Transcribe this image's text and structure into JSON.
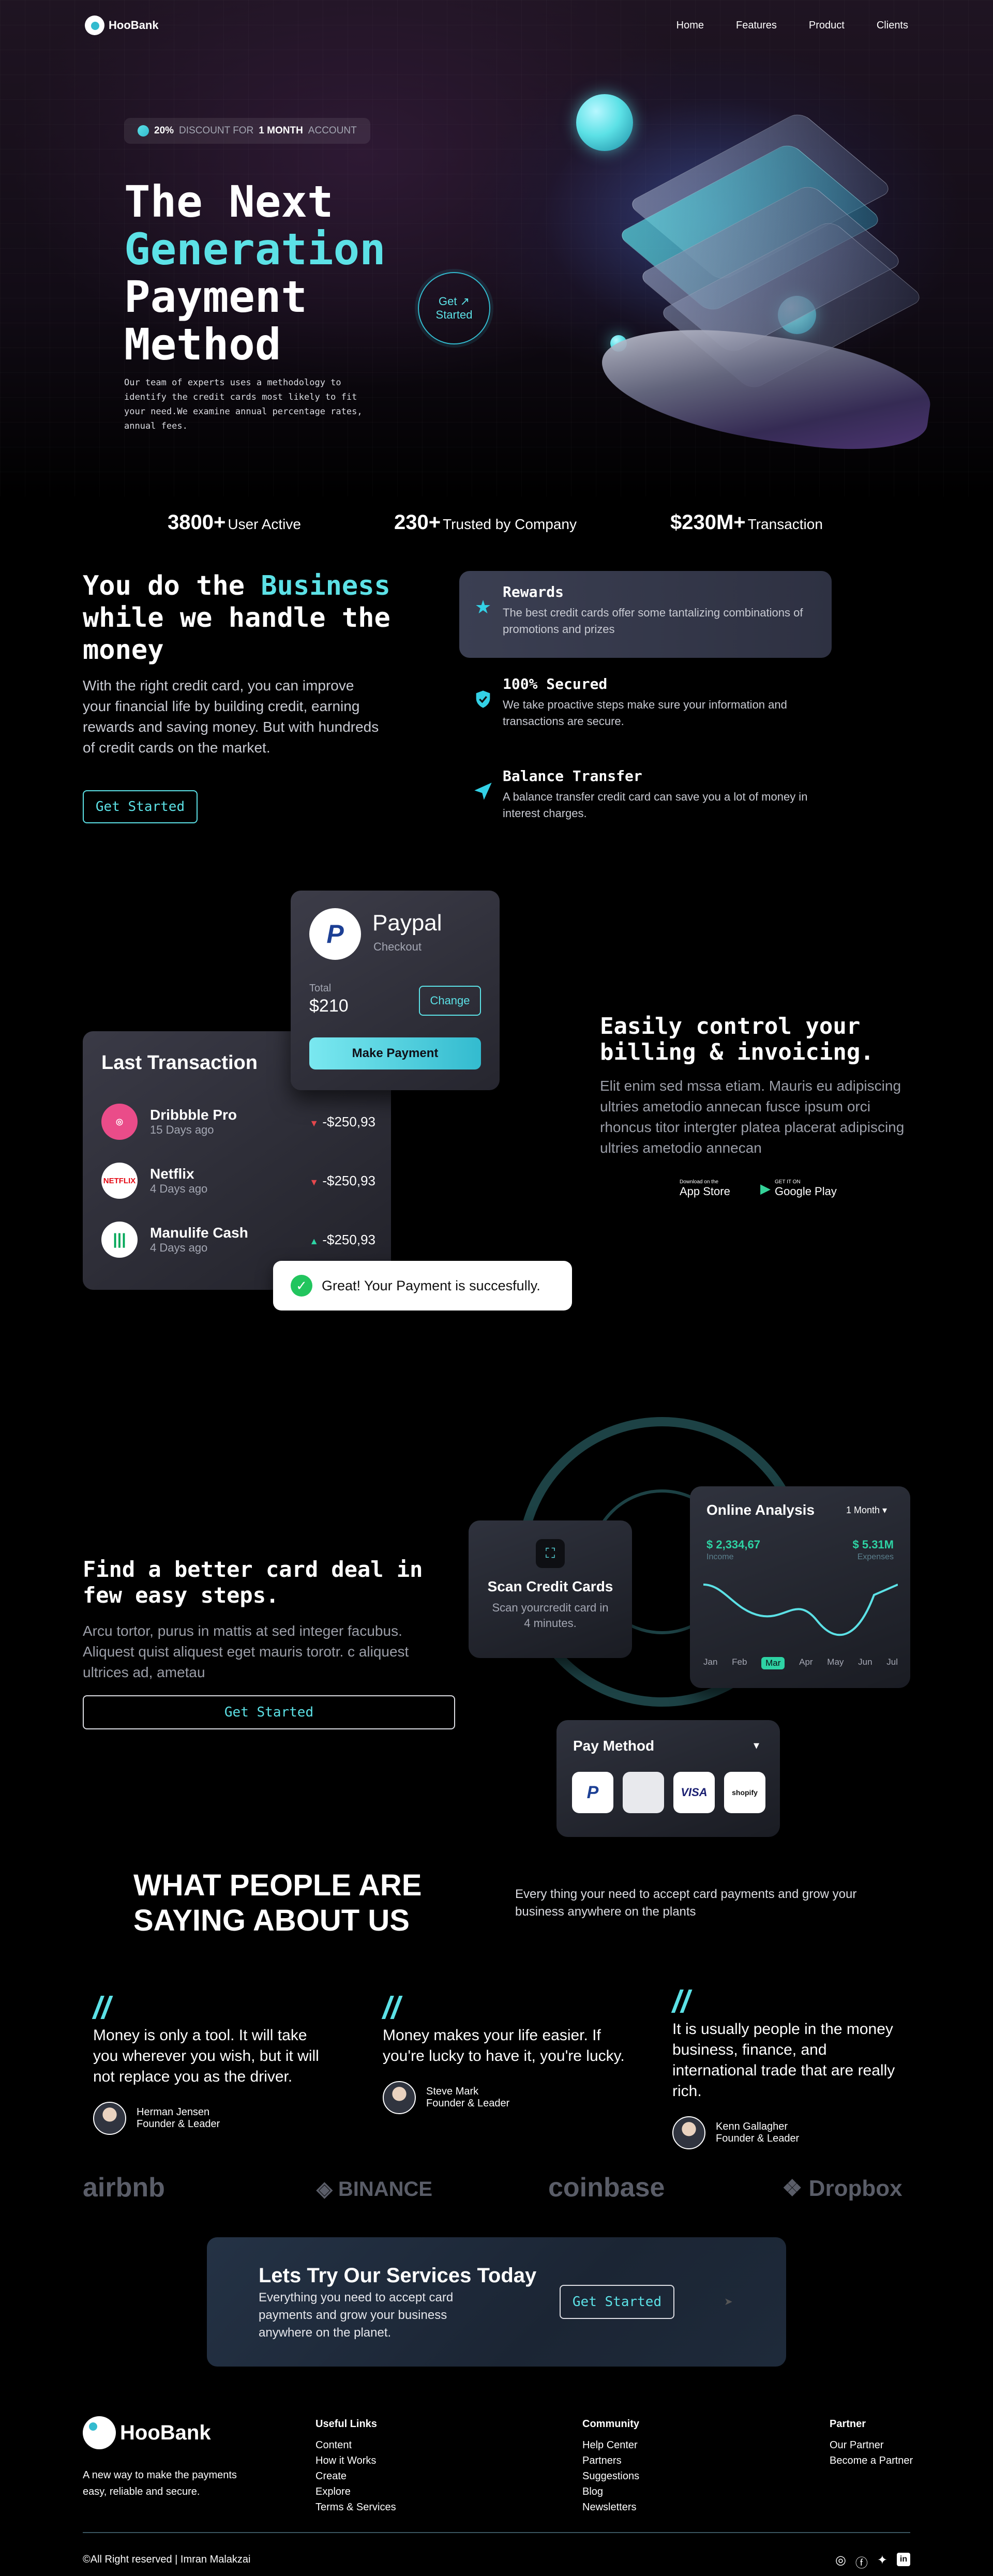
{
  "brand": {
    "name": "HooBank",
    "tagline": "A new way to make the payments easy, reliable and secure."
  },
  "nav": [
    "Home",
    "Features",
    "Product",
    "Clients"
  ],
  "hero": {
    "badge_pct": "20%",
    "badge_text1": "DISCOUNT FOR",
    "badge_text2": "1 MONTH",
    "badge_text3": "ACCOUNT",
    "title_line1": "The Next",
    "title_line2": "Generation",
    "title_line3": "Payment",
    "title_line4": "Method",
    "desc": "Our team of experts uses a methodology to identify the credit cards most likely to fit your need.We examine annual percentage rates, annual fees.",
    "cta_line1": "Get",
    "cta_line2": "Started"
  },
  "stats": [
    {
      "value": "3800+",
      "label": "User Active"
    },
    {
      "value": "230+",
      "label": "Trusted by Company"
    },
    {
      "value": "$230M+",
      "label": "Transaction"
    }
  ],
  "business": {
    "title_a": "You do the ",
    "title_b": "Business",
    "title_c": "while we handle the",
    "title_d": "money",
    "desc": "With the right credit card, you can improve your financial life by building credit, earning rewards and saving money. But with hundreds of credit cards on the market.",
    "button": "Get Started",
    "features": [
      {
        "title": "Rewards",
        "text": "The best credit cards offer some tantalizing combinations of promotions and prizes",
        "icon": "star-icon"
      },
      {
        "title": "100% Secured",
        "text": "We take proactive steps make sure your information and transactions are secure.",
        "icon": "shield-icon"
      },
      {
        "title": "Balance Transfer",
        "text": "A balance transfer credit card can save you a lot of money in interest charges.",
        "icon": "send-icon"
      }
    ]
  },
  "billing": {
    "paypal_title": "Paypal",
    "paypal_sub": "Checkout",
    "total_label": "Total",
    "total_value": "$210",
    "change": "Change",
    "make_payment": "Make Payment",
    "last_tx_title": "Last Transaction",
    "transactions": [
      {
        "name": "Dribbble Pro",
        "date": "15 Days ago",
        "amount": "-$250,93",
        "dir": "down"
      },
      {
        "name": "Netflix",
        "date": "4 Days ago",
        "amount": "-$250,93",
        "dir": "down"
      },
      {
        "name": "Manulife Cash",
        "date": "4 Days ago",
        "amount": "-$250,93",
        "dir": "up"
      }
    ],
    "toast": "Great! Your Payment is succesfully.",
    "title_line1": "Easily control your",
    "title_line2": "billing & invoicing.",
    "desc": "Elit enim sed mssa etiam. Mauris eu adipiscing ultries ametodio annecan fusce ipsum orci rhoncus titor intergter platea placerat adipiscing ultries ametodio annecan",
    "app_store_small": "Download on the",
    "app_store": "App Store",
    "google_small": "GET IT ON",
    "google": "Google Play"
  },
  "card_deal": {
    "title_line1": "Find a better card deal in",
    "title_line2": "few easy steps.",
    "desc": "Arcu tortor, purus in mattis at sed integer facubus. Aliquest quist aliquest eget mauris torotr. c aliquest ultrices ad, ametau",
    "button": "Get Started",
    "scan_title": "Scan Credit Cards",
    "scan_desc": "Scan yourcredit card in 4 minutes.",
    "analysis_title": "Online Analysis",
    "period": "1 Month",
    "income_value": "$ 2,334,67",
    "income_label": "Income",
    "expense_value": "$ 5.31M",
    "expense_label": "Expenses",
    "months": [
      "Jan",
      "Feb",
      "Mar",
      "Apr",
      "May",
      "Jun",
      "Jul"
    ],
    "active_month": "Mar",
    "pay_title": "Pay Method",
    "pay_methods": [
      "paypal",
      "apple",
      "VISA",
      "shopify"
    ]
  },
  "testimonials": {
    "title_line1": "WHAT PEOPLE ARE",
    "title_line2": "SAYING ABOUT US",
    "desc": "Every thing your need to accept card payments and grow your business anywhere on the plants",
    "items": [
      {
        "text": "Money is only a tool. It will take you wherever you wish, but it will not replace you as the driver.",
        "name": "Herman Jensen",
        "role": "Founder & Leader"
      },
      {
        "text": "Money makes your life easier. If you're lucky to have it, you're lucky.",
        "name": "Steve Mark",
        "role": "Founder & Leader"
      },
      {
        "text": "It is usually people in the money business, finance, and international trade that are really rich.",
        "name": "Kenn Gallagher",
        "role": "Founder & Leader"
      }
    ]
  },
  "clients": [
    "airbnb",
    "BINANCE",
    "coinbase",
    "Dropbox"
  ],
  "cta": {
    "title": "Lets Try Our Services Today",
    "desc": "Everything you need to accept card payments and grow your business anywhere on the planet.",
    "button": "Get Started"
  },
  "footer": {
    "cols": [
      {
        "title": "Useful Links",
        "links": [
          "Content",
          "How it Works",
          "Create",
          "Explore",
          "Terms & Services"
        ]
      },
      {
        "title": "Community",
        "links": [
          "Help Center",
          "Partners",
          "Suggestions",
          "Blog",
          "Newsletters"
        ]
      },
      {
        "title": "Partner",
        "links": [
          "Our Partner",
          "Become a Partner"
        ]
      }
    ],
    "copyright": "©All Right reserved | Imran Malakzai",
    "social": [
      "instagram-icon",
      "facebook-icon",
      "twitter-icon",
      "linkedin-icon"
    ]
  },
  "colors": {
    "accent": "#5ce1e6",
    "accent2": "#33bbcf",
    "bg": "#000000"
  }
}
